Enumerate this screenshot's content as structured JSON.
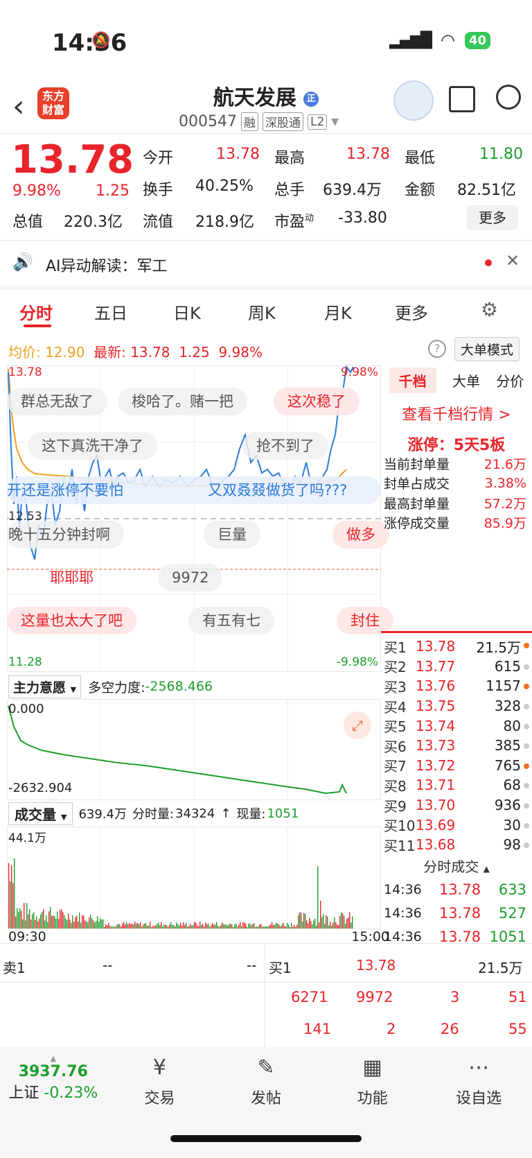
{
  "status": {
    "time": "14:36",
    "battery": "40"
  },
  "header": {
    "logo_text": "东方\n财富",
    "stock_name": "航天发展",
    "stock_code": "000547",
    "tags": [
      "融",
      "深股通",
      "L2"
    ]
  },
  "quote": {
    "price": "13.78",
    "change_pct": "9.98%",
    "change": "1.25",
    "open_label": "今开",
    "open": "13.78",
    "high_label": "最高",
    "high": "13.78",
    "low_label": "最低",
    "low": "11.80",
    "turnover_label": "换手",
    "turnover": "40.25%",
    "volume_label": "总手",
    "volume": "639.4万",
    "amount_label": "金额",
    "amount": "82.51亿",
    "mktcap_label": "总值",
    "mktcap": "220.3亿",
    "float_label": "流值",
    "float": "218.9亿",
    "pe_label": "市盈",
    "pe_sup": "动",
    "pe": "-33.80",
    "more": "更多"
  },
  "ai_banner": {
    "text": "AI异动解读：军工"
  },
  "tabs": [
    "分时",
    "五日",
    "日K",
    "周K",
    "月K",
    "更多"
  ],
  "chart_info": {
    "avg_label": "均价:",
    "avg": "12.90",
    "latest_label": "最新:",
    "latest": "13.78",
    "latest_chg": "1.25",
    "latest_pct": "9.98%",
    "big_order": "大单模式",
    "top_price": "13.78",
    "top_pct": "9.98%",
    "mid_price": "12.53",
    "low_price": "11.28",
    "low_pct": "-9.98%"
  },
  "danmu": [
    "群总无敌了",
    "梭哈了。赌一把",
    "这次稳了",
    "这下真洗干净了",
    "抢不到了",
    "开还是涨停不要怕",
    "又双叒叕做货了吗???",
    "晚十五分钟封啊",
    "巨量",
    "做多",
    "耶耶耶",
    "9972",
    "这量也太大了吧",
    "有五有七",
    "封住"
  ],
  "indicator": {
    "name": "主力意愿",
    "label": "多空力度:",
    "value": "-2568.466",
    "top": "0.000",
    "bottom": "-2632.904"
  },
  "volume_panel": {
    "name": "成交量",
    "total": "639.4万",
    "min_label": "分时量:",
    "min_value": "34324",
    "now_label": "现量:",
    "now_value": "1051",
    "top": "44.1万",
    "start": "09:30",
    "end": "15:00"
  },
  "right_panel": {
    "tabs": [
      "千档",
      "大单",
      "分价"
    ],
    "link": "查看千档行情 >",
    "limit_title": "涨停：5天5板",
    "stats": [
      {
        "label": "当前封单量",
        "value": "21.6万"
      },
      {
        "label": "封单占成交",
        "value": "3.38%"
      },
      {
        "label": "最高封单量",
        "value": "57.2万"
      },
      {
        "label": "涨停成交量",
        "value": "85.9万"
      }
    ],
    "bids": [
      {
        "label": "买1",
        "price": "13.78",
        "vol": "21.5万",
        "dot": "#f07020"
      },
      {
        "label": "买2",
        "price": "13.77",
        "vol": "615",
        "dot": "#ccc"
      },
      {
        "label": "买3",
        "price": "13.76",
        "vol": "1157",
        "dot": "#f07020"
      },
      {
        "label": "买4",
        "price": "13.75",
        "vol": "328",
        "dot": "#ccc"
      },
      {
        "label": "买5",
        "price": "13.74",
        "vol": "80",
        "dot": "#ccc"
      },
      {
        "label": "买6",
        "price": "13.73",
        "vol": "385",
        "dot": "#ccc"
      },
      {
        "label": "买7",
        "price": "13.72",
        "vol": "765",
        "dot": "#f07020"
      },
      {
        "label": "买8",
        "price": "13.71",
        "vol": "68",
        "dot": "#ccc"
      },
      {
        "label": "买9",
        "price": "13.70",
        "vol": "936",
        "dot": "#ccc"
      },
      {
        "label": "买10",
        "price": "13.69",
        "vol": "30",
        "dot": "#ccc"
      },
      {
        "label": "买11",
        "price": "13.68",
        "vol": "98",
        "dot": "#ccc"
      }
    ],
    "ticks_title": "分时成交",
    "ticks": [
      {
        "time": "14:36",
        "price": "13.78",
        "vol": "633"
      },
      {
        "time": "14:36",
        "price": "13.78",
        "vol": "527"
      },
      {
        "time": "14:36",
        "price": "13.78",
        "vol": "1051"
      }
    ]
  },
  "orderbook": {
    "sell_label": "卖1",
    "sell_price": "--",
    "sell_vol": "--",
    "buy_label": "买1",
    "buy_price": "13.78",
    "buy_vol": "21.5万",
    "row1": [
      "6271",
      "9972",
      "3",
      "51"
    ],
    "row2": [
      "141",
      "2",
      "26",
      "55"
    ]
  },
  "bottom_nav": {
    "index_value": "3937.76",
    "index_name": "上证",
    "index_pct": "-0.23%",
    "items": [
      {
        "label": "交易",
        "icon": "yen-cycle-icon"
      },
      {
        "label": "发帖",
        "icon": "edit-icon"
      },
      {
        "label": "功能",
        "icon": "grid-icon"
      },
      {
        "label": "设自选",
        "icon": "more-circle-icon"
      }
    ]
  },
  "colors": {
    "up": "#e8242a",
    "down": "#1c9e2c",
    "price_line": "#2b7ad8",
    "avg_line": "#f0a020"
  }
}
